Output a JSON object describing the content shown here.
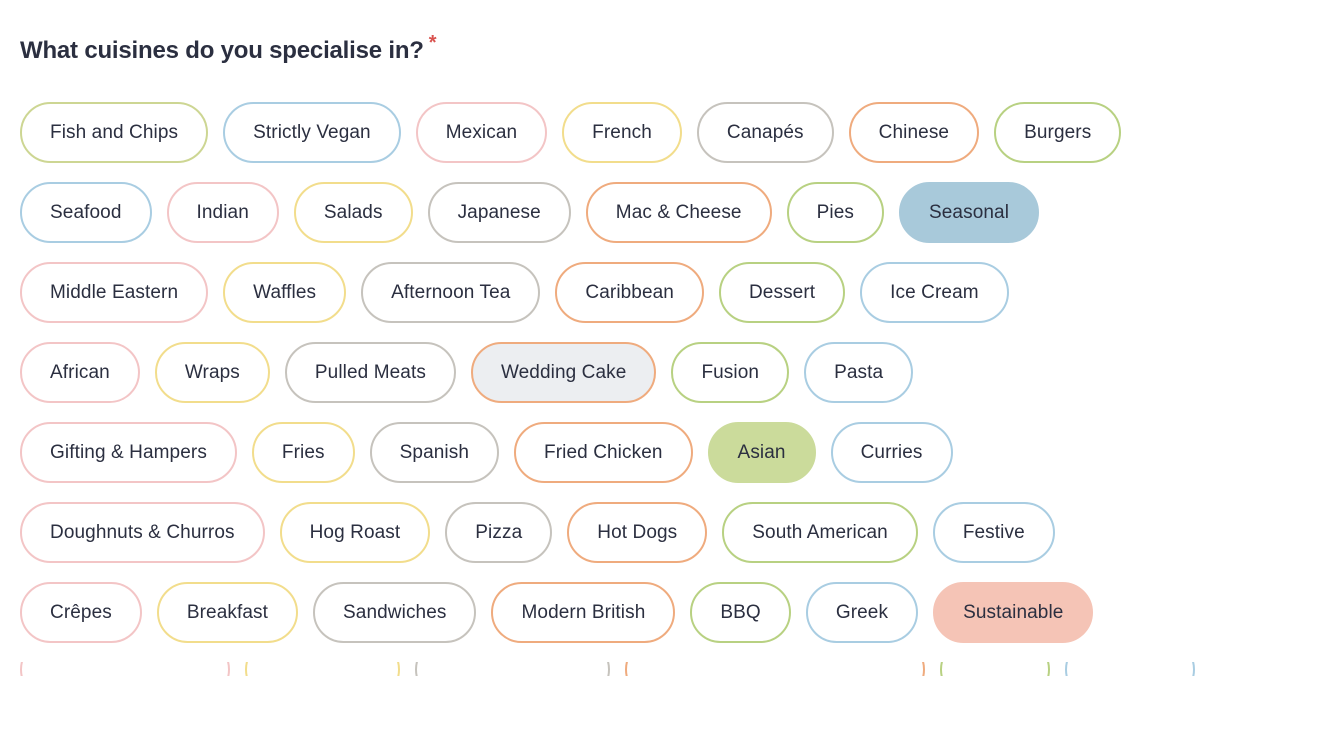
{
  "question": {
    "label": "What cuisines do you specialise in?",
    "required_marker": "*",
    "required_color": "#d9534f",
    "text_color": "#2b2f40"
  },
  "palette": {
    "olive": "#cdd693",
    "green": "#b8d182",
    "blue": "#a9cde2",
    "pink": "#f3c5c6",
    "yellow": "#f2dd8c",
    "gray": "#c6c3bd",
    "orange": "#efab7e",
    "chip_text": "#2b2f40",
    "chip_background": "#ffffff",
    "hover_background": "#eceef1",
    "selected_blue_fill": "#a8c9da",
    "selected_green_fill": "#cbdb9b",
    "selected_salmon_fill": "#f5c4b6"
  },
  "chip_rows": [
    [
      {
        "label": "Fish and Chips",
        "border": "#cdd693",
        "fill": "#ffffff",
        "state": "default"
      },
      {
        "label": "Strictly Vegan",
        "border": "#a9cde2",
        "fill": "#ffffff",
        "state": "default"
      },
      {
        "label": "Mexican",
        "border": "#f3c5c6",
        "fill": "#ffffff",
        "state": "default"
      },
      {
        "label": "French",
        "border": "#f2dd8c",
        "fill": "#ffffff",
        "state": "default"
      },
      {
        "label": "Canapés",
        "border": "#c6c3bd",
        "fill": "#ffffff",
        "state": "default"
      },
      {
        "label": "Chinese",
        "border": "#efab7e",
        "fill": "#ffffff",
        "state": "default"
      },
      {
        "label": "Burgers",
        "border": "#b8d182",
        "fill": "#ffffff",
        "state": "default"
      }
    ],
    [
      {
        "label": "Seafood",
        "border": "#a9cde2",
        "fill": "#ffffff",
        "state": "default"
      },
      {
        "label": "Indian",
        "border": "#f3c5c6",
        "fill": "#ffffff",
        "state": "default"
      },
      {
        "label": "Salads",
        "border": "#f2dd8c",
        "fill": "#ffffff",
        "state": "default"
      },
      {
        "label": "Japanese",
        "border": "#c6c3bd",
        "fill": "#ffffff",
        "state": "default"
      },
      {
        "label": "Mac & Cheese",
        "border": "#efab7e",
        "fill": "#ffffff",
        "state": "default"
      },
      {
        "label": "Pies",
        "border": "#b8d182",
        "fill": "#ffffff",
        "state": "default"
      },
      {
        "label": "Seasonal",
        "border": "#a8c9da",
        "fill": "#a8c9da",
        "state": "selected"
      }
    ],
    [
      {
        "label": "Middle Eastern",
        "border": "#f3c5c6",
        "fill": "#ffffff",
        "state": "default"
      },
      {
        "label": "Waffles",
        "border": "#f2dd8c",
        "fill": "#ffffff",
        "state": "default"
      },
      {
        "label": "Afternoon Tea",
        "border": "#c6c3bd",
        "fill": "#ffffff",
        "state": "default"
      },
      {
        "label": "Caribbean",
        "border": "#efab7e",
        "fill": "#ffffff",
        "state": "default"
      },
      {
        "label": "Dessert",
        "border": "#b8d182",
        "fill": "#ffffff",
        "state": "default"
      },
      {
        "label": "Ice Cream",
        "border": "#a9cde2",
        "fill": "#ffffff",
        "state": "default"
      }
    ],
    [
      {
        "label": "African",
        "border": "#f3c5c6",
        "fill": "#ffffff",
        "state": "default"
      },
      {
        "label": "Wraps",
        "border": "#f2dd8c",
        "fill": "#ffffff",
        "state": "default"
      },
      {
        "label": "Pulled Meats",
        "border": "#c6c3bd",
        "fill": "#ffffff",
        "state": "default"
      },
      {
        "label": "Wedding Cake",
        "border": "#efab7e",
        "fill": "#eceef1",
        "state": "hovered"
      },
      {
        "label": "Fusion",
        "border": "#b8d182",
        "fill": "#ffffff",
        "state": "default"
      },
      {
        "label": "Pasta",
        "border": "#a9cde2",
        "fill": "#ffffff",
        "state": "default"
      }
    ],
    [
      {
        "label": "Gifting & Hampers",
        "border": "#f3c5c6",
        "fill": "#ffffff",
        "state": "default"
      },
      {
        "label": "Fries",
        "border": "#f2dd8c",
        "fill": "#ffffff",
        "state": "default"
      },
      {
        "label": "Spanish",
        "border": "#c6c3bd",
        "fill": "#ffffff",
        "state": "default"
      },
      {
        "label": "Fried Chicken",
        "border": "#efab7e",
        "fill": "#ffffff",
        "state": "default"
      },
      {
        "label": "Asian",
        "border": "#cbdb9b",
        "fill": "#cbdb9b",
        "state": "selected"
      },
      {
        "label": "Curries",
        "border": "#a9cde2",
        "fill": "#ffffff",
        "state": "default"
      }
    ],
    [
      {
        "label": "Doughnuts & Churros",
        "border": "#f3c5c6",
        "fill": "#ffffff",
        "state": "default"
      },
      {
        "label": "Hog Roast",
        "border": "#f2dd8c",
        "fill": "#ffffff",
        "state": "default"
      },
      {
        "label": "Pizza",
        "border": "#c6c3bd",
        "fill": "#ffffff",
        "state": "default"
      },
      {
        "label": "Hot Dogs",
        "border": "#efab7e",
        "fill": "#ffffff",
        "state": "default"
      },
      {
        "label": "South American",
        "border": "#b8d182",
        "fill": "#ffffff",
        "state": "default"
      },
      {
        "label": "Festive",
        "border": "#a9cde2",
        "fill": "#ffffff",
        "state": "default"
      }
    ],
    [
      {
        "label": "Crêpes",
        "border": "#f3c5c6",
        "fill": "#ffffff",
        "state": "default"
      },
      {
        "label": "Breakfast",
        "border": "#f2dd8c",
        "fill": "#ffffff",
        "state": "default"
      },
      {
        "label": "Sandwiches",
        "border": "#c6c3bd",
        "fill": "#ffffff",
        "state": "default"
      },
      {
        "label": "Modern British",
        "border": "#efab7e",
        "fill": "#ffffff",
        "state": "default"
      },
      {
        "label": "BBQ",
        "border": "#b8d182",
        "fill": "#ffffff",
        "state": "default"
      },
      {
        "label": "Greek",
        "border": "#a9cde2",
        "fill": "#ffffff",
        "state": "default"
      },
      {
        "label": "Sustainable",
        "border": "#f5c4b6",
        "fill": "#f5c4b6",
        "state": "selected"
      }
    ],
    [
      {
        "label": "",
        "border": "#f3c5c6",
        "fill": "#ffffff",
        "state": "clipped"
      },
      {
        "label": "",
        "border": "#f2dd8c",
        "fill": "#ffffff",
        "state": "clipped"
      },
      {
        "label": "",
        "border": "#c6c3bd",
        "fill": "#ffffff",
        "state": "clipped"
      },
      {
        "label": "",
        "border": "#efab7e",
        "fill": "#ffffff",
        "state": "clipped"
      },
      {
        "label": "",
        "border": "#b8d182",
        "fill": "#ffffff",
        "state": "clipped"
      },
      {
        "label": "",
        "border": "#a9cde2",
        "fill": "#ffffff",
        "state": "clipped"
      }
    ]
  ],
  "clipped_row_widths": [
    210,
    155,
    195,
    300,
    110,
    130
  ]
}
